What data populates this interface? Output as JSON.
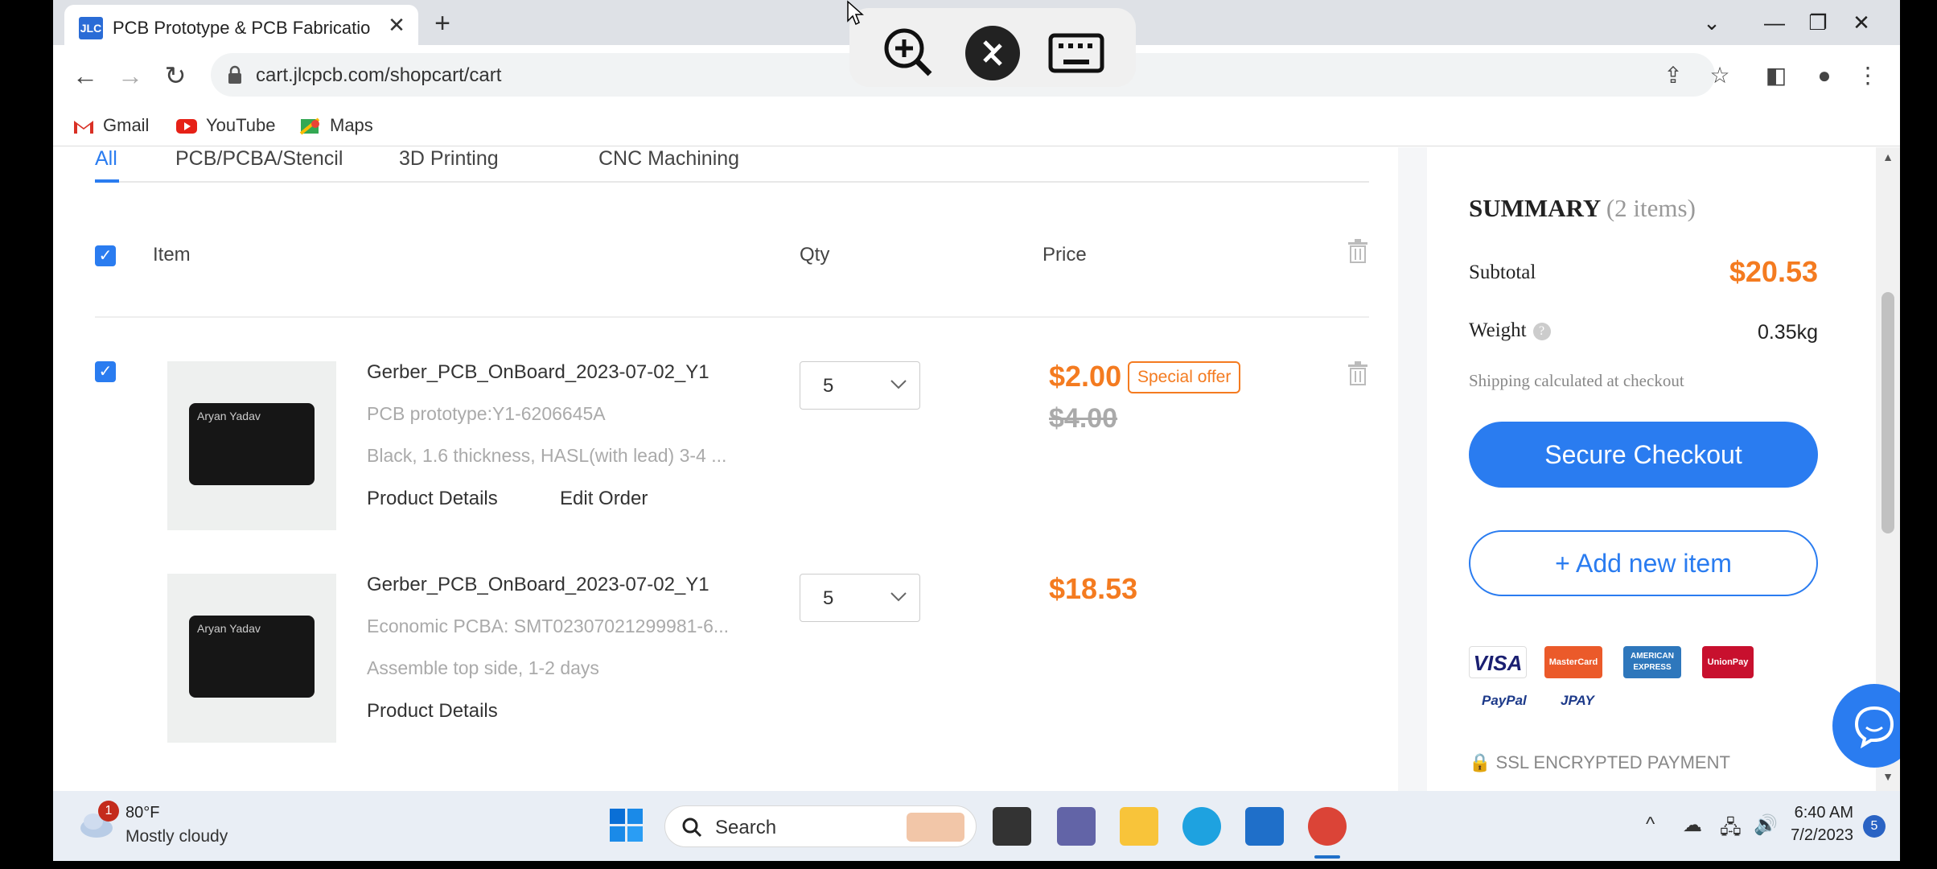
{
  "browser": {
    "tab_title": "PCB Prototype & PCB Fabrication",
    "favicon_text": "JLC",
    "tab_close": "✕",
    "new_tab": "+",
    "url": "cart.jlcpcb.com/shopcart/cart",
    "window_controls": {
      "dropdown": "⌄",
      "minimize": "—",
      "restore": "❐",
      "close": "✕"
    },
    "nav": {
      "back": "←",
      "forward": "→",
      "reload": "↻"
    },
    "bookmarks": [
      {
        "label": "Gmail",
        "icon": "gmail-icon"
      },
      {
        "label": "YouTube",
        "icon": "youtube-icon"
      },
      {
        "label": "Maps",
        "icon": "maps-icon"
      }
    ]
  },
  "remote_toolbar": {
    "icons": [
      "zoom-in-icon",
      "remote-desktop-icon",
      "keyboard-icon"
    ]
  },
  "cart": {
    "filter_tabs": [
      "All",
      "PCB/PCBA/Stencil",
      "3D Printing",
      "CNC Machining"
    ],
    "active_tab": "All",
    "headers": {
      "item": "Item",
      "qty": "Qty",
      "price": "Price"
    },
    "items": [
      {
        "name": "Gerber_PCB_OnBoard_2023-07-02_Y1",
        "line1": "PCB prototype:Y1-6206645A",
        "line2": "Black, 1.6 thickness, HASL(with lead) 3-4 ...",
        "links": [
          "Product Details",
          "Edit Order"
        ],
        "qty": "5",
        "price": "$2.00",
        "old_price": "$4.00",
        "badge": "Special offer",
        "thumb_text": "Aryan Yadav"
      },
      {
        "name": "Gerber_PCB_OnBoard_2023-07-02_Y1",
        "line1": "Economic PCBA: SMT02307021299981-6...",
        "line2": "Assemble top side, 1-2 days",
        "links": [
          "Product Details"
        ],
        "qty": "5",
        "price": "$18.53",
        "thumb_text": "Aryan Yadav"
      }
    ]
  },
  "summary": {
    "title": "SUMMARY",
    "count": "(2 items)",
    "subtotal_label": "Subtotal",
    "subtotal_value": "$20.53",
    "weight_label": "Weight",
    "weight_help": "?",
    "weight_value": "0.35kg",
    "shipping_note": "Shipping calculated at checkout",
    "checkout_label": "Secure Checkout",
    "add_item_label": "+   Add new item",
    "payments": [
      "VISA",
      "MasterCard",
      "AMERICAN EXPRESS",
      "UnionPay",
      "PayPal",
      "JPAY"
    ],
    "ssl": "SSL ENCRYPTED PAYMENT"
  },
  "taskbar": {
    "weather_temp": "80°F",
    "weather_desc": "Mostly cloudy",
    "weather_badge": "1",
    "search_label": "Search",
    "time": "6:40 AM",
    "date": "7/2/2023",
    "notifications": "5",
    "tray_chevron": "^"
  },
  "colors": {
    "accent": "#2a7cf0",
    "price": "#f47b20"
  }
}
